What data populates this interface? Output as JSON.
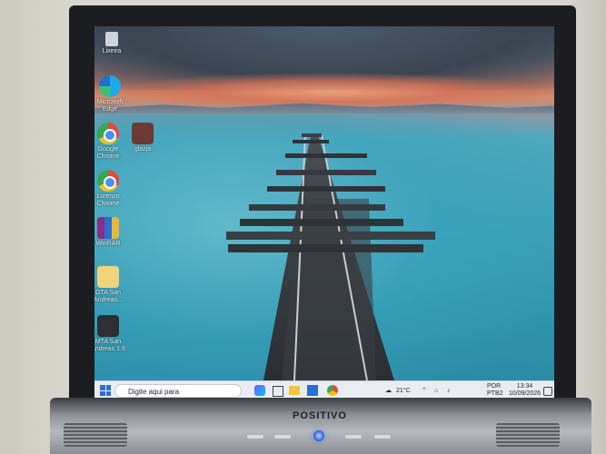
{
  "monitor": {
    "brand": "POSITIVO"
  },
  "desktop_icons": [
    {
      "name": "lixeira-icon",
      "label": "Lixeira"
    },
    {
      "name": "edge-icon",
      "label": "Microsoft Edge"
    },
    {
      "name": "chrome-icon",
      "label": "Google Chrome"
    },
    {
      "name": "chrome-icon-2",
      "label": "Lorenzo Chrome"
    },
    {
      "name": "winrar-icon",
      "label": "WinRAR"
    },
    {
      "name": "gta-folder-icon",
      "label": "GTA San Andreas..."
    },
    {
      "name": "mta-icon",
      "label": "MTA San Andreas 1.6"
    },
    {
      "name": "user-folder-icon",
      "label": "glazja"
    },
    {
      "name": "gta-top-icon",
      "label": "GTA San Andreas"
    }
  ],
  "taskbar": {
    "search_placeholder": "Digite aqui para",
    "weather": "21°C",
    "lang_1": "POR",
    "lang_2": "PTB2",
    "time": "13:34",
    "date": "10/09/2026"
  }
}
